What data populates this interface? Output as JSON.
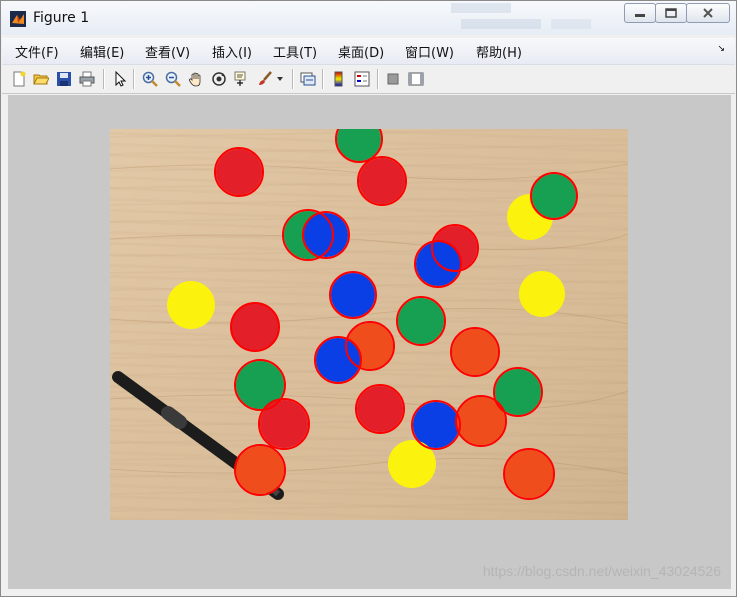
{
  "window": {
    "title": "Figure 1",
    "buttons": [
      "minimize-icon",
      "restore-icon",
      "close-icon"
    ]
  },
  "menu": {
    "items": [
      "文件(F)",
      "编辑(E)",
      "查看(V)",
      "插入(I)",
      "工具(T)",
      "桌面(D)",
      "窗口(W)",
      "帮助(H)"
    ]
  },
  "toolbar": {
    "tools": [
      "new-figure-icon",
      "open-file-icon",
      "save-icon",
      "print-icon",
      "edit-plot-arrow-icon",
      "zoom-in-icon",
      "zoom-out-icon",
      "pan-hand-icon",
      "rotate-3d-icon",
      "data-cursor-icon",
      "brush-icon",
      "brush-dropdown-icon",
      "link-plot-icon",
      "colorbar-icon",
      "legend-icon",
      "hide-plot-tools-icon",
      "show-plot-tools-icon"
    ]
  },
  "image": {
    "description_colors": {
      "red": "#e3202a",
      "green": "#17a052",
      "blue": "#0a3fe6",
      "orange": "#f04d1c",
      "yellow": "#fbf20e",
      "circle": "#ff0000"
    }
  },
  "watermark": "https://blog.csdn.net/weixin_43024526"
}
